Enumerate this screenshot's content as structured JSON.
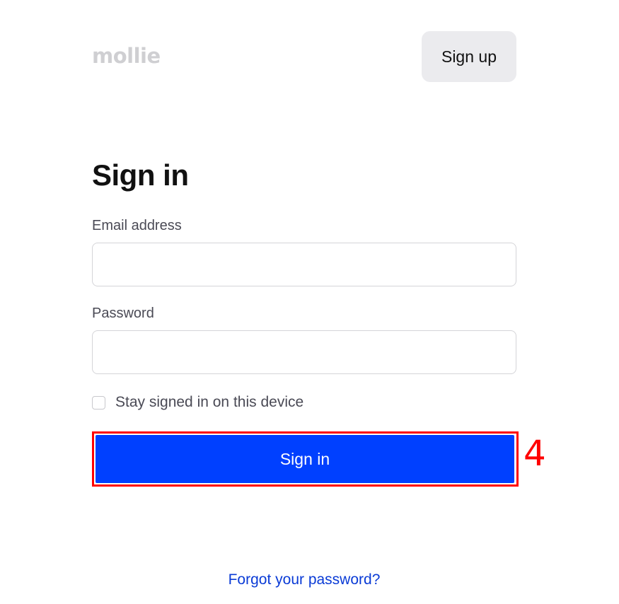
{
  "header": {
    "logo_text": "mollie",
    "signup_label": "Sign up"
  },
  "form": {
    "title": "Sign in",
    "email": {
      "label": "Email address",
      "value": "",
      "placeholder": ""
    },
    "password": {
      "label": "Password",
      "value": "",
      "placeholder": ""
    },
    "stay_signed_in": {
      "label": "Stay signed in on this device",
      "checked": false
    },
    "submit_label": "Sign in",
    "forgot_label": "Forgot your password?"
  },
  "annotation": {
    "marker_label": "4",
    "color": "#ff0000"
  },
  "colors": {
    "primary": "#0040ff",
    "link": "#0a3bd6",
    "logo": "#cfcfd2"
  }
}
